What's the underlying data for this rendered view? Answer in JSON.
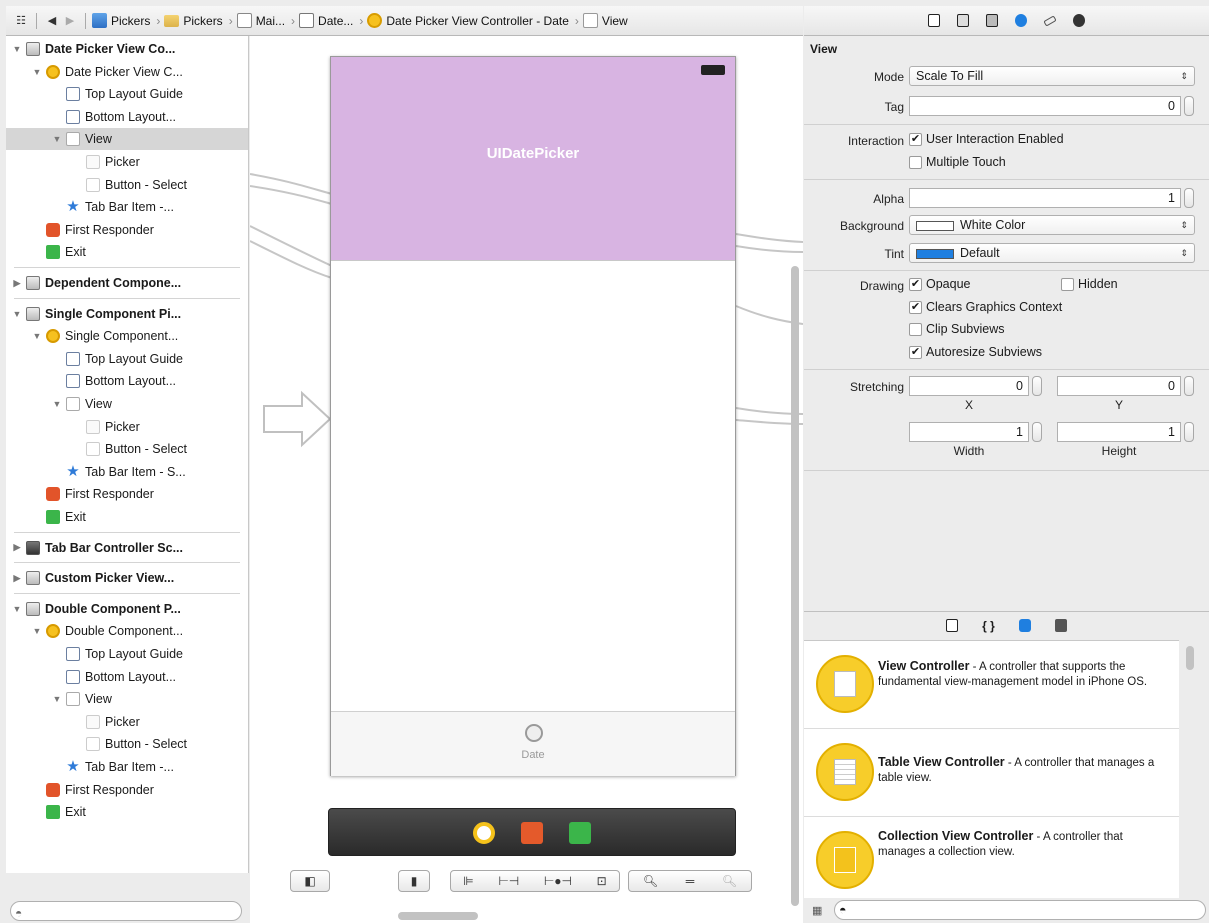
{
  "jumpbar": {
    "crumbs": [
      "Pickers",
      "Pickers",
      "Mai...",
      "Date...",
      "Date Picker View Controller - Date",
      "View"
    ]
  },
  "outline": {
    "rows": [
      {
        "label": "Date Picker View Co...",
        "level": 0,
        "tri": "▼",
        "icon": "scene",
        "bold": true
      },
      {
        "label": "Date Picker View C...",
        "level": 1,
        "tri": "▼",
        "icon": "vc"
      },
      {
        "label": "Top Layout Guide",
        "level": 2,
        "tri": "",
        "icon": "guide"
      },
      {
        "label": "Bottom Layout...",
        "level": 2,
        "tri": "",
        "icon": "guide"
      },
      {
        "label": "View",
        "level": 2,
        "tri": "▼",
        "icon": "view",
        "selected": true
      },
      {
        "label": "Picker",
        "level": 3,
        "tri": "",
        "icon": "picker"
      },
      {
        "label": "Button - Select",
        "level": 3,
        "tri": "",
        "icon": "btn"
      },
      {
        "label": "Tab Bar Item -...",
        "level": 2,
        "tri": "",
        "icon": "star"
      },
      {
        "label": "First Responder",
        "level": 1,
        "tri": "",
        "icon": "cube"
      },
      {
        "label": "Exit",
        "level": 1,
        "tri": "",
        "icon": "exit"
      },
      {
        "label": "Dependent Compone...",
        "level": 0,
        "tri": "▶",
        "icon": "scene",
        "bold": true
      },
      {
        "label": "Single Component Pi...",
        "level": 0,
        "tri": "▼",
        "icon": "scene",
        "bold": true
      },
      {
        "label": "Single Component...",
        "level": 1,
        "tri": "▼",
        "icon": "vc"
      },
      {
        "label": "Top Layout Guide",
        "level": 2,
        "tri": "",
        "icon": "guide"
      },
      {
        "label": "Bottom Layout...",
        "level": 2,
        "tri": "",
        "icon": "guide"
      },
      {
        "label": "View",
        "level": 2,
        "tri": "▼",
        "icon": "view"
      },
      {
        "label": "Picker",
        "level": 3,
        "tri": "",
        "icon": "picker"
      },
      {
        "label": "Button - Select",
        "level": 3,
        "tri": "",
        "icon": "btn"
      },
      {
        "label": "Tab Bar Item - S...",
        "level": 2,
        "tri": "",
        "icon": "star"
      },
      {
        "label": "First Responder",
        "level": 1,
        "tri": "",
        "icon": "cube"
      },
      {
        "label": "Exit",
        "level": 1,
        "tri": "",
        "icon": "exit"
      },
      {
        "label": "Tab Bar Controller Sc...",
        "level": 0,
        "tri": "▶",
        "icon": "tabbar",
        "bold": true
      },
      {
        "label": "Custom Picker View...",
        "level": 0,
        "tri": "▶",
        "icon": "scene",
        "bold": true
      },
      {
        "label": "Double Component P...",
        "level": 0,
        "tri": "▼",
        "icon": "scene",
        "bold": true
      },
      {
        "label": "Double Component...",
        "level": 1,
        "tri": "▼",
        "icon": "vc"
      },
      {
        "label": "Top Layout Guide",
        "level": 2,
        "tri": "",
        "icon": "guide"
      },
      {
        "label": "Bottom Layout...",
        "level": 2,
        "tri": "",
        "icon": "guide"
      },
      {
        "label": "View",
        "level": 2,
        "tri": "▼",
        "icon": "view"
      },
      {
        "label": "Picker",
        "level": 3,
        "tri": "",
        "icon": "picker"
      },
      {
        "label": "Button - Select",
        "level": 3,
        "tri": "",
        "icon": "btn"
      },
      {
        "label": "Tab Bar Item -...",
        "level": 2,
        "tri": "",
        "icon": "star"
      },
      {
        "label": "First Responder",
        "level": 1,
        "tri": "",
        "icon": "cube"
      },
      {
        "label": "Exit",
        "level": 1,
        "tri": "",
        "icon": "exit"
      }
    ]
  },
  "canvas": {
    "date_picker_label": "UIDatePicker",
    "tab_label": "Date"
  },
  "inspector": {
    "section": "View",
    "mode_label": "Mode",
    "mode_value": "Scale To Fill",
    "tag_label": "Tag",
    "tag_value": "0",
    "interaction_label": "Interaction",
    "user_interaction": "User Interaction Enabled",
    "multiple_touch": "Multiple Touch",
    "alpha_label": "Alpha",
    "alpha_value": "1",
    "background_label": "Background",
    "background_value": "White Color",
    "tint_label": "Tint",
    "tint_value": "Default",
    "drawing_label": "Drawing",
    "opaque": "Opaque",
    "hidden": "Hidden",
    "clears": "Clears Graphics Context",
    "clip": "Clip Subviews",
    "autoresize": "Autoresize Subviews",
    "stretching_label": "Stretching",
    "stretch_x": "0",
    "stretch_y": "0",
    "stretch_w": "1",
    "stretch_h": "1",
    "x_label": "X",
    "y_label": "Y",
    "width_label": "Width",
    "height_label": "Height"
  },
  "library": {
    "items": [
      {
        "title": "View Controller",
        "desc": " - A controller that supports the fundamental view-management model in iPhone OS."
      },
      {
        "title": "Table View Controller",
        "desc": " - A controller that manages a table view."
      },
      {
        "title": "Collection View Controller",
        "desc": " - A controller that manages a collection view."
      }
    ]
  },
  "colors": {
    "date_picker": "#d8b4e2",
    "tint": "#1f7fe0",
    "accent_yellow": "#f7cd2a"
  }
}
